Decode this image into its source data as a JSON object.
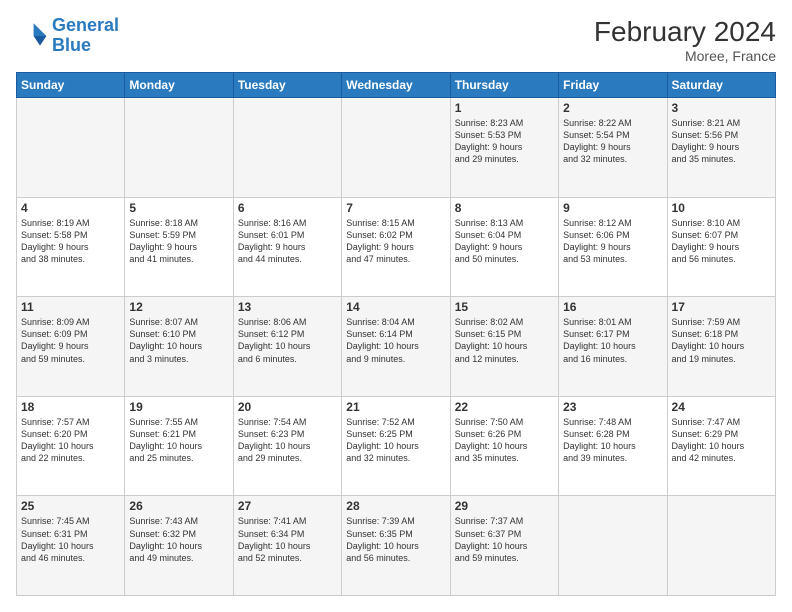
{
  "header": {
    "logo_line1": "General",
    "logo_line2": "Blue",
    "month_title": "February 2024",
    "location": "Moree, France"
  },
  "weekdays": [
    "Sunday",
    "Monday",
    "Tuesday",
    "Wednesday",
    "Thursday",
    "Friday",
    "Saturday"
  ],
  "weeks": [
    [
      {
        "day": "",
        "info": ""
      },
      {
        "day": "",
        "info": ""
      },
      {
        "day": "",
        "info": ""
      },
      {
        "day": "",
        "info": ""
      },
      {
        "day": "1",
        "info": "Sunrise: 8:23 AM\nSunset: 5:53 PM\nDaylight: 9 hours\nand 29 minutes."
      },
      {
        "day": "2",
        "info": "Sunrise: 8:22 AM\nSunset: 5:54 PM\nDaylight: 9 hours\nand 32 minutes."
      },
      {
        "day": "3",
        "info": "Sunrise: 8:21 AM\nSunset: 5:56 PM\nDaylight: 9 hours\nand 35 minutes."
      }
    ],
    [
      {
        "day": "4",
        "info": "Sunrise: 8:19 AM\nSunset: 5:58 PM\nDaylight: 9 hours\nand 38 minutes."
      },
      {
        "day": "5",
        "info": "Sunrise: 8:18 AM\nSunset: 5:59 PM\nDaylight: 9 hours\nand 41 minutes."
      },
      {
        "day": "6",
        "info": "Sunrise: 8:16 AM\nSunset: 6:01 PM\nDaylight: 9 hours\nand 44 minutes."
      },
      {
        "day": "7",
        "info": "Sunrise: 8:15 AM\nSunset: 6:02 PM\nDaylight: 9 hours\nand 47 minutes."
      },
      {
        "day": "8",
        "info": "Sunrise: 8:13 AM\nSunset: 6:04 PM\nDaylight: 9 hours\nand 50 minutes."
      },
      {
        "day": "9",
        "info": "Sunrise: 8:12 AM\nSunset: 6:06 PM\nDaylight: 9 hours\nand 53 minutes."
      },
      {
        "day": "10",
        "info": "Sunrise: 8:10 AM\nSunset: 6:07 PM\nDaylight: 9 hours\nand 56 minutes."
      }
    ],
    [
      {
        "day": "11",
        "info": "Sunrise: 8:09 AM\nSunset: 6:09 PM\nDaylight: 9 hours\nand 59 minutes."
      },
      {
        "day": "12",
        "info": "Sunrise: 8:07 AM\nSunset: 6:10 PM\nDaylight: 10 hours\nand 3 minutes."
      },
      {
        "day": "13",
        "info": "Sunrise: 8:06 AM\nSunset: 6:12 PM\nDaylight: 10 hours\nand 6 minutes."
      },
      {
        "day": "14",
        "info": "Sunrise: 8:04 AM\nSunset: 6:14 PM\nDaylight: 10 hours\nand 9 minutes."
      },
      {
        "day": "15",
        "info": "Sunrise: 8:02 AM\nSunset: 6:15 PM\nDaylight: 10 hours\nand 12 minutes."
      },
      {
        "day": "16",
        "info": "Sunrise: 8:01 AM\nSunset: 6:17 PM\nDaylight: 10 hours\nand 16 minutes."
      },
      {
        "day": "17",
        "info": "Sunrise: 7:59 AM\nSunset: 6:18 PM\nDaylight: 10 hours\nand 19 minutes."
      }
    ],
    [
      {
        "day": "18",
        "info": "Sunrise: 7:57 AM\nSunset: 6:20 PM\nDaylight: 10 hours\nand 22 minutes."
      },
      {
        "day": "19",
        "info": "Sunrise: 7:55 AM\nSunset: 6:21 PM\nDaylight: 10 hours\nand 25 minutes."
      },
      {
        "day": "20",
        "info": "Sunrise: 7:54 AM\nSunset: 6:23 PM\nDaylight: 10 hours\nand 29 minutes."
      },
      {
        "day": "21",
        "info": "Sunrise: 7:52 AM\nSunset: 6:25 PM\nDaylight: 10 hours\nand 32 minutes."
      },
      {
        "day": "22",
        "info": "Sunrise: 7:50 AM\nSunset: 6:26 PM\nDaylight: 10 hours\nand 35 minutes."
      },
      {
        "day": "23",
        "info": "Sunrise: 7:48 AM\nSunset: 6:28 PM\nDaylight: 10 hours\nand 39 minutes."
      },
      {
        "day": "24",
        "info": "Sunrise: 7:47 AM\nSunset: 6:29 PM\nDaylight: 10 hours\nand 42 minutes."
      }
    ],
    [
      {
        "day": "25",
        "info": "Sunrise: 7:45 AM\nSunset: 6:31 PM\nDaylight: 10 hours\nand 46 minutes."
      },
      {
        "day": "26",
        "info": "Sunrise: 7:43 AM\nSunset: 6:32 PM\nDaylight: 10 hours\nand 49 minutes."
      },
      {
        "day": "27",
        "info": "Sunrise: 7:41 AM\nSunset: 6:34 PM\nDaylight: 10 hours\nand 52 minutes."
      },
      {
        "day": "28",
        "info": "Sunrise: 7:39 AM\nSunset: 6:35 PM\nDaylight: 10 hours\nand 56 minutes."
      },
      {
        "day": "29",
        "info": "Sunrise: 7:37 AM\nSunset: 6:37 PM\nDaylight: 10 hours\nand 59 minutes."
      },
      {
        "day": "",
        "info": ""
      },
      {
        "day": "",
        "info": ""
      }
    ]
  ]
}
